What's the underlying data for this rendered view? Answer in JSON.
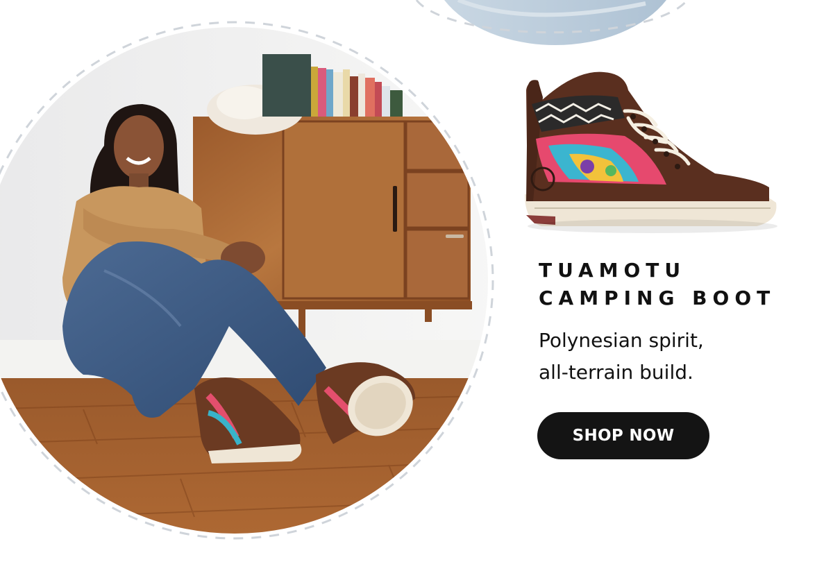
{
  "product": {
    "title_line1": "TUAMOTU",
    "title_line2": "CAMPING BOOT",
    "tagline_line1": "Polynesian spirit,",
    "tagline_line2": "all-terrain build."
  },
  "cta": {
    "label": "SHOP NOW"
  },
  "images": {
    "lifestyle_photo": "woman-sitting-on-wood-floor-wearing-boots",
    "product_photo": "brown-leather-high-top-boot-with-woven-panel"
  },
  "colors": {
    "button_bg": "#141414",
    "button_text": "#ffffff",
    "text": "#111111",
    "dash_ring": "#cfd4da"
  }
}
